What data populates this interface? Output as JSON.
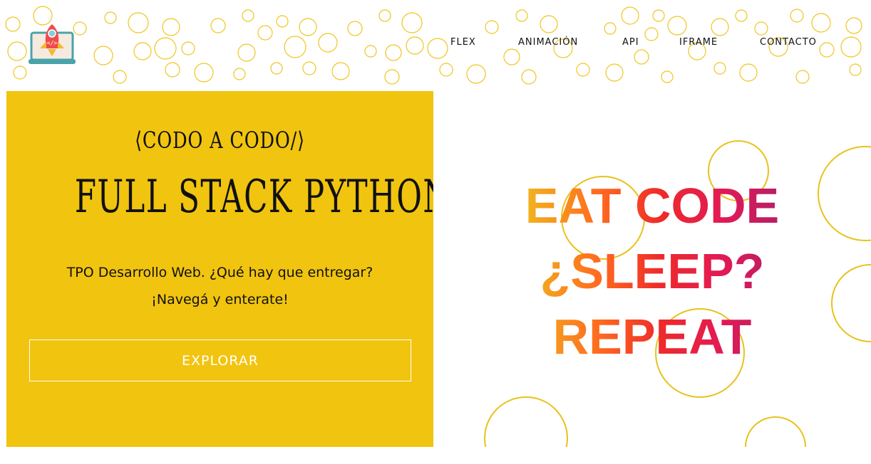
{
  "nav": {
    "items": [
      "FLEX",
      "ANIMACIÓN",
      "API",
      "IFRAME",
      "CONTACTO"
    ]
  },
  "hero": {
    "subtitle": "⟨CODO A CODO/⟩",
    "title": "FULL STACK PYTHON",
    "description_line1": "TPO Desarrollo Web. ¿Qué hay que entregar?",
    "description_line2": "¡Navegá y enterate!",
    "button_label": "EXPLORAR"
  },
  "slogan": {
    "line1": "EAT CODE",
    "line2": "¿SLEEP?",
    "line3": "REPEAT"
  },
  "colors": {
    "accent": "#f1c40f",
    "bubble": "#f0c520",
    "gradient_start": "#e6c518",
    "gradient_mid": "#ee2a2a",
    "gradient_end": "#5d2a72"
  },
  "icons": {
    "logo": "rocket-laptop-icon"
  }
}
